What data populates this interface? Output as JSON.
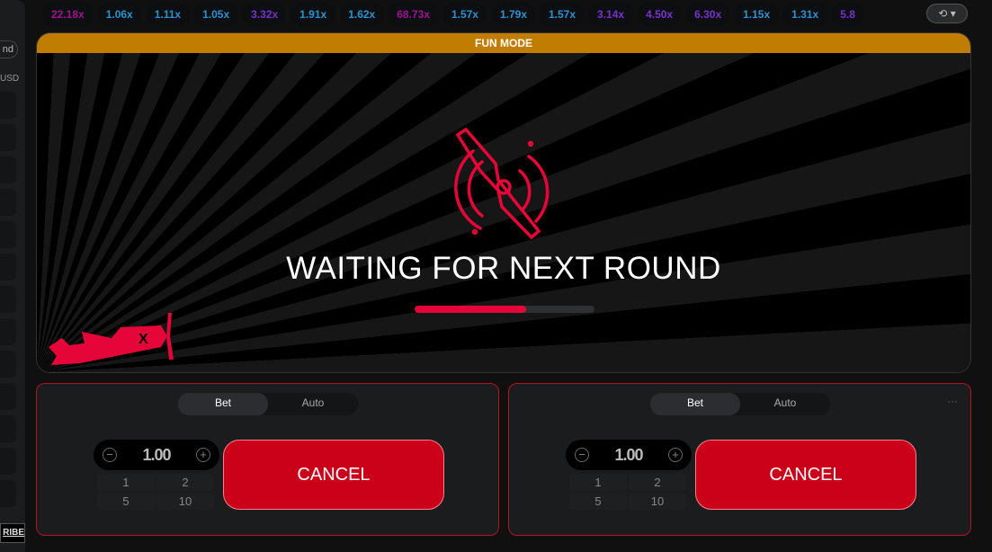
{
  "sidebar": {
    "pill_label": "nd",
    "currency": "USD",
    "brand_text": "RIBE"
  },
  "history": {
    "multipliers": [
      {
        "value": "22.18x",
        "color": "#c017b4"
      },
      {
        "value": "1.06x",
        "color": "#34b4ff"
      },
      {
        "value": "1.11x",
        "color": "#34b4ff"
      },
      {
        "value": "1.05x",
        "color": "#34b4ff"
      },
      {
        "value": "3.32x",
        "color": "#913ef8"
      },
      {
        "value": "1.91x",
        "color": "#34b4ff"
      },
      {
        "value": "1.62x",
        "color": "#34b4ff"
      },
      {
        "value": "68.73x",
        "color": "#c017b4"
      },
      {
        "value": "1.57x",
        "color": "#34b4ff"
      },
      {
        "value": "1.79x",
        "color": "#34b4ff"
      },
      {
        "value": "1.57x",
        "color": "#34b4ff"
      },
      {
        "value": "3.14x",
        "color": "#913ef8"
      },
      {
        "value": "4.50x",
        "color": "#913ef8"
      },
      {
        "value": "6.30x",
        "color": "#913ef8"
      },
      {
        "value": "1.15x",
        "color": "#34b4ff"
      },
      {
        "value": "1.31x",
        "color": "#34b4ff"
      },
      {
        "value": "5.8",
        "color": "#913ef8"
      }
    ],
    "history_icon": "history-clock-icon"
  },
  "game": {
    "mode_label": "FUN MODE",
    "status": "WAITING FOR NEXT ROUND",
    "progress": 0.62,
    "accent": "#e50539"
  },
  "panels": [
    {
      "tabs": [
        "Bet",
        "Auto"
      ],
      "active_tab": "Bet",
      "amount": "1.00",
      "quick": [
        "1",
        "2",
        "5",
        "10"
      ],
      "action": "CANCEL"
    },
    {
      "tabs": [
        "Bet",
        "Auto"
      ],
      "active_tab": "Bet",
      "amount": "1.00",
      "quick": [
        "1",
        "2",
        "5",
        "10"
      ],
      "action": "CANCEL",
      "more": "···"
    }
  ]
}
